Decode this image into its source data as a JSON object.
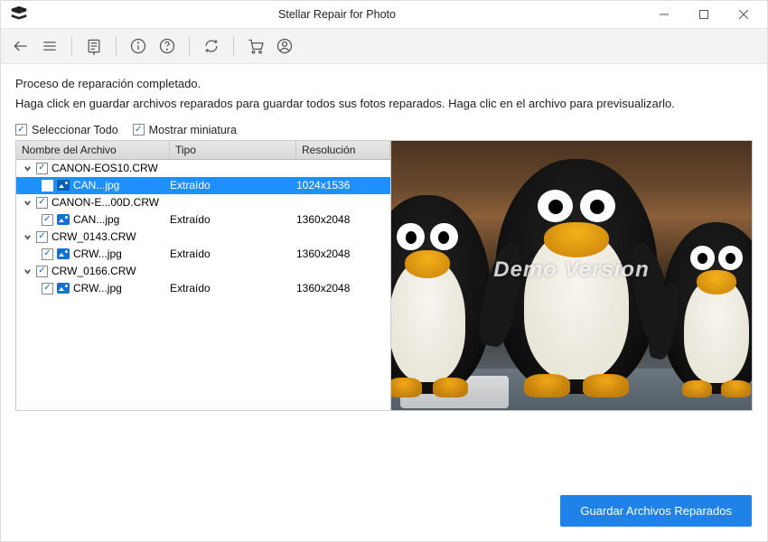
{
  "window": {
    "title": "Stellar Repair for Photo"
  },
  "content": {
    "heading": "Proceso de reparación completado.",
    "subtext": "Haga click en guardar archivos reparados para guardar todos sus fotos reparados. Haga clic en el archivo para previsualizarlo."
  },
  "options": {
    "select_all": "Seleccionar Todo",
    "show_thumb": "Mostrar miniatura",
    "select_all_checked": true,
    "show_thumb_checked": true
  },
  "table": {
    "headers": {
      "name": "Nombre del Archivo",
      "type": "Tipo",
      "res": "Resolución"
    },
    "groups": [
      {
        "name": "CANON-EOS10.CRW",
        "children": [
          {
            "name": "CAN...jpg",
            "type": "Extraído",
            "res": "1024x1536",
            "selected": true
          }
        ]
      },
      {
        "name": "CANON-E...00D.CRW",
        "children": [
          {
            "name": "CAN...jpg",
            "type": "Extraído",
            "res": "1360x2048",
            "selected": false
          }
        ]
      },
      {
        "name": "CRW_0143.CRW",
        "children": [
          {
            "name": "CRW...jpg",
            "type": "Extraído",
            "res": "1360x2048",
            "selected": false
          }
        ]
      },
      {
        "name": "CRW_0166.CRW",
        "children": [
          {
            "name": "CRW...jpg",
            "type": "Extraído",
            "res": "1360x2048",
            "selected": false
          }
        ]
      }
    ]
  },
  "preview": {
    "watermark": "Demo Version"
  },
  "footer": {
    "save_btn": "Guardar Archivos Reparados"
  }
}
